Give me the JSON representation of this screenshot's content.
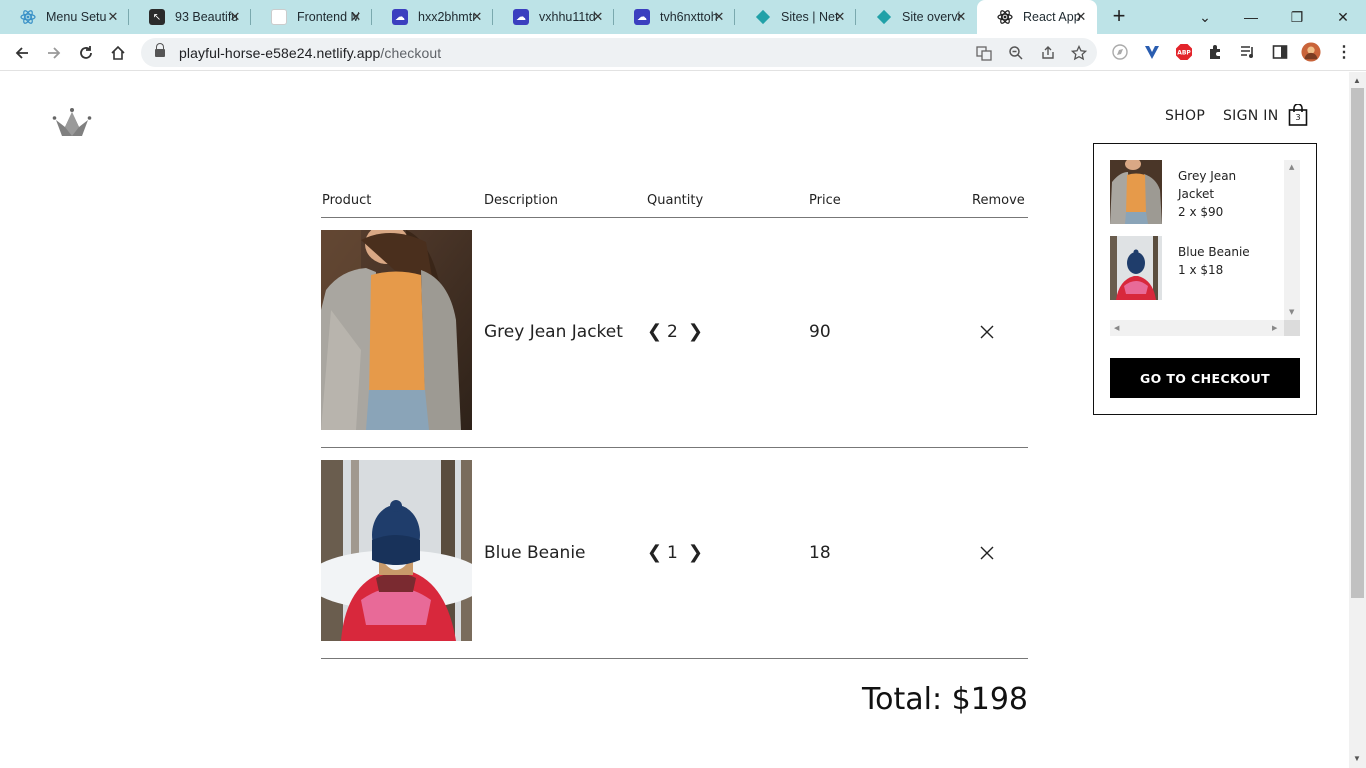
{
  "browser": {
    "tabs": [
      {
        "title": "Menu Setu",
        "favicon": "react-icon",
        "color": "#3ea8c9"
      },
      {
        "title": "93 Beautifu",
        "favicon": "cursor-icon",
        "color": "#2b2b2b"
      },
      {
        "title": "Frontend M",
        "favicon": "page-icon",
        "color": "#cccccc"
      },
      {
        "title": "hxx2bhmtr",
        "favicon": "cloud-icon",
        "color": "#3b3fbf"
      },
      {
        "title": "vxhhu11td",
        "favicon": "cloud-icon",
        "color": "#3b3fbf"
      },
      {
        "title": "tvh6nxttoh",
        "favicon": "cloud-icon",
        "color": "#3b3fbf"
      },
      {
        "title": "Sites | Net",
        "favicon": "netlify-icon",
        "color": "#21a1a8"
      },
      {
        "title": "Site overvi",
        "favicon": "netlify-icon",
        "color": "#21a1a8"
      },
      {
        "title": "React App",
        "favicon": "react-icon",
        "color": "#222222"
      }
    ],
    "url_host": "playful-horse-e58e24.netlify.app",
    "url_path": "/checkout"
  },
  "header": {
    "logo_name": "crown-logo",
    "shop_label": "SHOP",
    "signin_label": "SIGN IN",
    "cart_count": "3"
  },
  "checkout": {
    "columns": [
      "Product",
      "Description",
      "Quantity",
      "Price",
      "Remove"
    ],
    "items": [
      {
        "name": "Grey Jean Jacket",
        "quantity": "2",
        "price": "90",
        "prev": "❮",
        "next": "❯",
        "remove": "✕"
      },
      {
        "name": "Blue Beanie",
        "quantity": "1",
        "price": "18",
        "prev": "❮",
        "next": "❯",
        "remove": "✕"
      }
    ],
    "total": "Total: $198"
  },
  "dropdown": {
    "items": [
      {
        "name_line1": "Grey Jean",
        "name_line2": "Jacket",
        "qty_price": "2 x $90"
      },
      {
        "name_line1": "Blue Beanie",
        "name_line2": "",
        "qty_price": "1 x $18"
      }
    ],
    "button_label": "GO TO CHECKOUT"
  }
}
